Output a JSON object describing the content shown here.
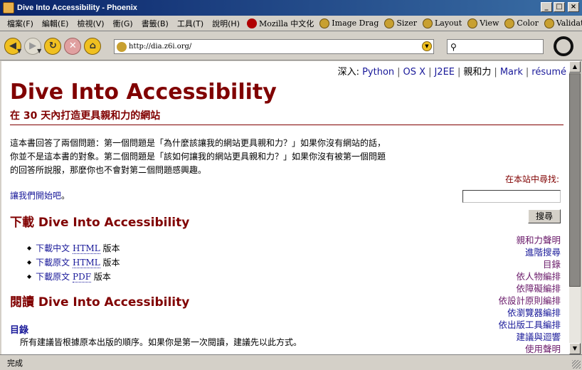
{
  "window": {
    "title": "Dive Into Accessibility - Phoenix",
    "buttons": {
      "minimize": "_",
      "maximize": "□",
      "close": "×"
    }
  },
  "menu": {
    "items": [
      "檔案(F)",
      "編輯(E)",
      "檢視(V)",
      "衝(G)",
      "書籤(B)",
      "工具(T)",
      "說明(H)"
    ],
    "extensions": [
      "Mozilla 中文化",
      "Image Drag",
      "Sizer",
      "Layout",
      "View",
      "Color",
      "Validate"
    ]
  },
  "toolbar": {
    "url": "http://dia.z6i.org/",
    "search_placeholder": ""
  },
  "page": {
    "deep_nav_prefix": "深入:",
    "deep_nav": [
      "Python",
      "OS X",
      "J2EE",
      "親和力",
      "Mark",
      "résumé"
    ],
    "title": "Dive Into Accessibility",
    "subtitle": "在 30 天內打造更具親和力的網站",
    "intro": "這本書回答了兩個問題：第一個問題是「為什麼該讓我的網站更具親和力？」如果你沒有網站的話，你並不是這本書的對象。第二個問題是「該如何讓我的網站更具親和力？」如果你沒有被第一個問題的回答所說服，那麼你也不會對第二個問題感興趣。",
    "start_link": "讓我們開始吧",
    "start_punct": "。",
    "download_heading": "下載 Dive Into Accessibility",
    "downloads": [
      {
        "link": "下載中文",
        "format": "HTML",
        "suffix": " 版本"
      },
      {
        "link": "下載原文",
        "format": "HTML",
        "suffix": " 版本"
      },
      {
        "link": "下載原文",
        "format": "PDF",
        "suffix": " 版本"
      }
    ],
    "read_heading": "閱讀 Dive Into Accessibility",
    "toc_heading": "目錄",
    "toc_desc": "所有建議皆根據原本出版的順序。如果你是第一次閱讀，建議先以此方式。"
  },
  "sidebar": {
    "search_label": "在本站中尋找:",
    "search_button": "搜尋",
    "links": [
      "親和力聲明",
      "進階搜尋",
      "目錄",
      "依人物編排",
      "依障礙編排",
      "依設計原則編排",
      "依瀏覽器編排",
      "依出版工具編排",
      "建議與迴響",
      "使用聲明"
    ]
  },
  "status": {
    "text": "完成"
  }
}
